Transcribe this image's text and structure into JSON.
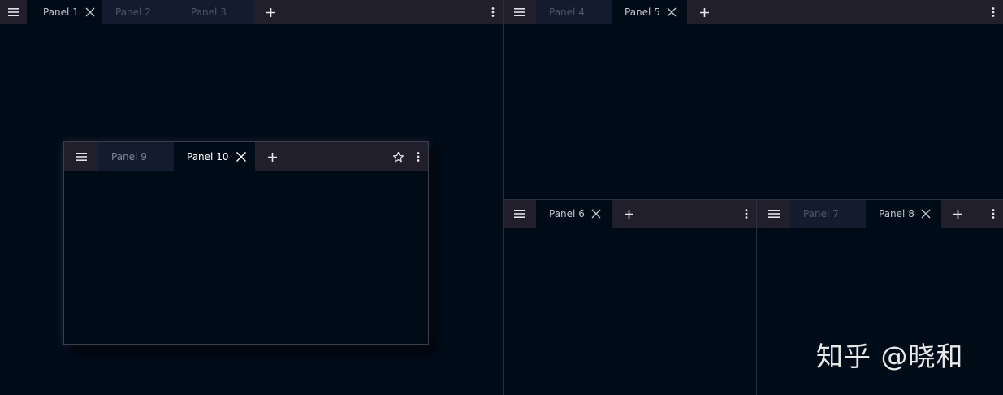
{
  "groups": {
    "top_left": {
      "tabs": [
        {
          "label": "Panel 1"
        },
        {
          "label": "Panel 2"
        },
        {
          "label": "Panel 3"
        }
      ]
    },
    "top_right": {
      "tabs": [
        {
          "label": "Panel 4"
        },
        {
          "label": "Panel 5"
        }
      ]
    },
    "bottom_mid": {
      "tabs": [
        {
          "label": "Panel 6"
        }
      ]
    },
    "bottom_right": {
      "tabs": [
        {
          "label": "Panel 7"
        },
        {
          "label": "Panel 8"
        }
      ]
    },
    "floating": {
      "tabs": [
        {
          "label": "Panel 9"
        },
        {
          "label": "Panel 10"
        }
      ]
    }
  },
  "icons": {
    "menu": "hamburger-menu-icon",
    "close": "close-icon",
    "add": "plus-icon",
    "more": "more-vertical-icon",
    "star": "star-icon"
  },
  "colors": {
    "background": "#000b18",
    "tabbar": "#221f2d",
    "inactive_tab": "#141b2e",
    "active_text": "#c2c6d0",
    "inactive_text": "#4d5566"
  },
  "watermark": "知乎 @晓和"
}
